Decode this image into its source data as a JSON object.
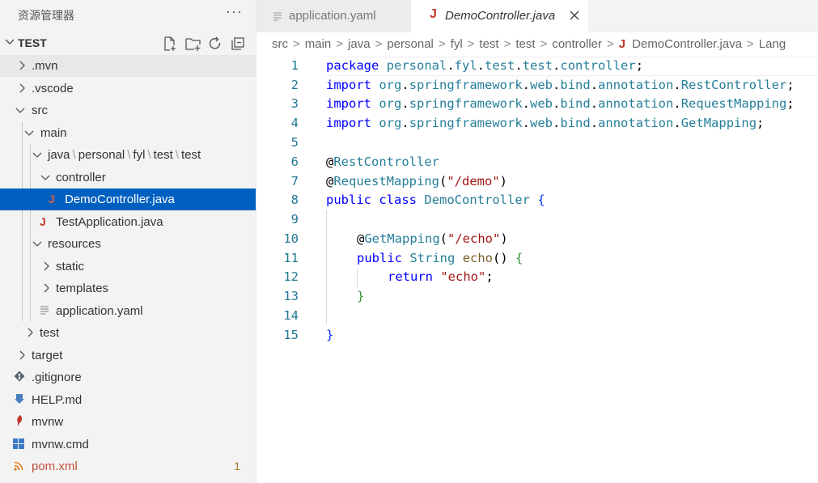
{
  "sidebar": {
    "title": "资源管理器",
    "more": "···",
    "section": "TEST",
    "items": [
      {
        "label": ".mvn",
        "badge": ""
      },
      {
        "label": ".vscode",
        "badge": ""
      },
      {
        "label": "src",
        "badge": ""
      },
      {
        "label": "main",
        "badge": ""
      },
      {
        "label": "java",
        "path_parts": [
          "personal",
          "fyl",
          "test",
          "test"
        ],
        "badge": ""
      },
      {
        "label": "controller",
        "badge": ""
      },
      {
        "label": "DemoController.java",
        "badge": ""
      },
      {
        "label": "TestApplication.java",
        "badge": ""
      },
      {
        "label": "resources",
        "badge": ""
      },
      {
        "label": "static",
        "badge": ""
      },
      {
        "label": "templates",
        "badge": ""
      },
      {
        "label": "application.yaml",
        "badge": ""
      },
      {
        "label": "test",
        "badge": ""
      },
      {
        "label": "target",
        "badge": ""
      },
      {
        "label": ".gitignore",
        "badge": ""
      },
      {
        "label": "HELP.md",
        "badge": ""
      },
      {
        "label": "mvnw",
        "badge": ""
      },
      {
        "label": "mvnw.cmd",
        "badge": ""
      },
      {
        "label": "pom.xml",
        "badge": "1"
      }
    ]
  },
  "tabs": [
    {
      "label": "application.yaml"
    },
    {
      "label": "DemoController.java",
      "active": true
    }
  ],
  "breadcrumb": [
    "src",
    "main",
    "java",
    "personal",
    "fyl",
    "test",
    "test",
    "controller",
    "DemoController.java",
    "Lang"
  ],
  "code": {
    "line_numbers": [
      "1",
      "2",
      "3",
      "4",
      "5",
      "6",
      "7",
      "8",
      "9",
      "10",
      "11",
      "12",
      "13",
      "14",
      "15"
    ],
    "tokens": {
      "package_kw": "package",
      "pkg_path": [
        "personal",
        "fyl",
        "test",
        "test",
        "controller"
      ],
      "import_kw": "import",
      "imp_base": [
        "org",
        "springframework",
        "web",
        "bind",
        "annotation"
      ],
      "imp1": "RestController",
      "imp2": "RequestMapping",
      "imp3": "GetMapping",
      "at": "@",
      "ann1": "RestController",
      "ann2": "RequestMapping",
      "ann2_arg": "\"/demo\"",
      "public_kw": "public",
      "class_kw": "class",
      "class_name": "DemoController",
      "ann3": "GetMapping",
      "ann3_arg": "\"/echo\"",
      "string_type": "String",
      "method": "echo",
      "return_kw": "return",
      "return_val": "\"echo\""
    }
  },
  "colors": {
    "selection": "#0060c0",
    "java_icon": "#c0392b",
    "keyword": "#0000ff",
    "type": "#267f99",
    "string": "#a31515"
  },
  "icons": {
    "new_file": "new-file-icon",
    "new_folder": "new-folder-icon",
    "refresh": "refresh-icon",
    "collapse": "collapse-all-icon"
  }
}
